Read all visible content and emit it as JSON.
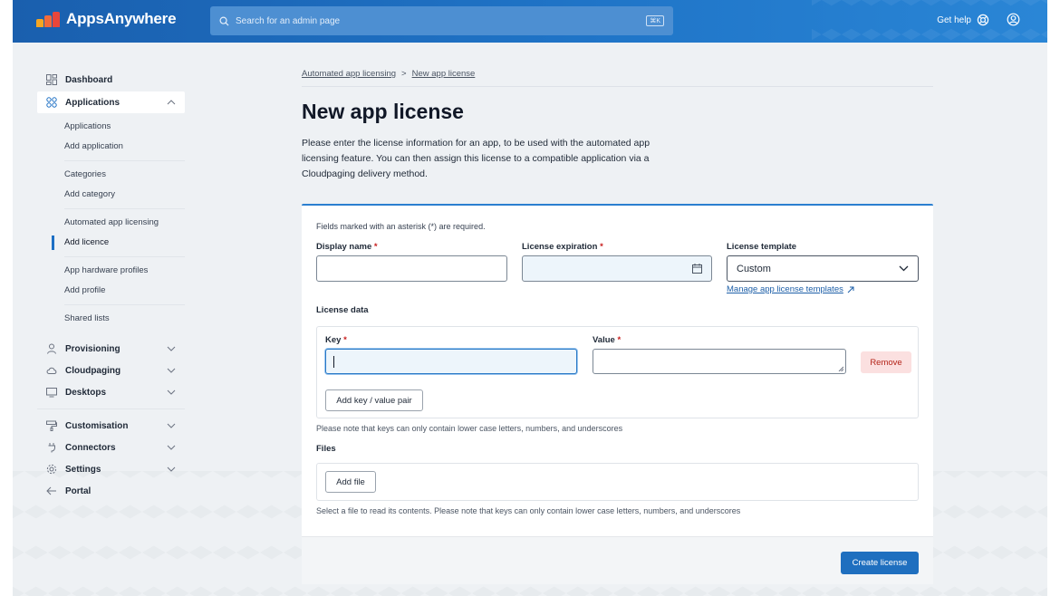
{
  "header": {
    "app_name": "AppsAnywhere",
    "search": {
      "placeholder": "Search for an admin page",
      "shortcut": "⌘K"
    },
    "help_label": "Get help",
    "icons": [
      "search-icon",
      "help-lifebuoy-icon",
      "user-icon"
    ]
  },
  "sidebar": {
    "dashboard": "Dashboard",
    "applications": "Applications",
    "applications_sub": {
      "group1": [
        "Applications",
        "Add application"
      ],
      "group2": [
        "Categories",
        "Add category"
      ],
      "group3": [
        "Automated app licensing",
        "Add licence"
      ],
      "group4": [
        "App hardware profiles",
        "Add profile"
      ],
      "group5": [
        "Shared lists"
      ]
    },
    "provisioning": "Provisioning",
    "cloudpaging": "Cloudpaging",
    "desktops": "Desktops",
    "customisation": "Customisation",
    "connectors": "Connectors",
    "settings": "Settings",
    "portal": "Portal"
  },
  "breadcrumb": {
    "parent": "Automated app licensing",
    "separator": ">",
    "current": "New app license"
  },
  "page": {
    "title": "New app license",
    "intro": "Please enter the license information for an app, to be used with the automated app licensing feature. You can then assign this license to a compatible application via a Cloudpaging delivery method."
  },
  "form": {
    "required_note": "Fields marked with an asterisk (*) are required.",
    "display_name_label": "Display name",
    "license_expiration_label": "License expiration",
    "license_template_label": "License template",
    "license_template_value": "Custom",
    "required_marker": "*",
    "manage_templates_link": "Manage app license templates",
    "license_data_label": "License data",
    "key_label": "Key",
    "value_label": "Value",
    "key_value": "",
    "value_value": "",
    "remove_label": "Remove",
    "add_pair_label": "Add key / value pair",
    "keys_hint": "Please note that keys can only contain lower case letters, numbers, and underscores",
    "files_label": "Files",
    "add_file_label": "Add file",
    "files_hint": "Select a file to read its contents. Please note that keys can only contain lower case letters, numbers, and underscores",
    "create_label": "Create license"
  },
  "colors": {
    "brand_blue": "#1f74c7",
    "primary_button": "#1f6fbf",
    "remove_bg": "#fbe0e0",
    "required_red": "#c81e1e"
  }
}
